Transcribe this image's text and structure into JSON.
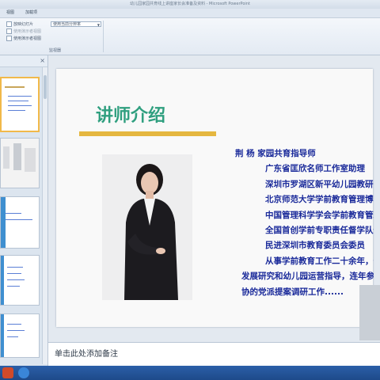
{
  "window": {
    "title": "幼儿园家园共育线上讲座家长会准备及资料 - Microsoft PowerPoint"
  },
  "menu": {
    "items": [
      "视图",
      "加载项"
    ]
  },
  "ribbon": {
    "options": [
      "放映幻灯片",
      "使用演示者视图",
      "使用演示者视图"
    ],
    "combo_value": "使用当前分辨率",
    "group_label": "监视器"
  },
  "slide": {
    "title": "讲师介绍",
    "bio_lines": [
      "荆  杨   家园共育指导师",
      "广东省匡欣名师工作室助理",
      "深圳市罗湖区新平幼儿园教研员",
      "北京师范大学学前教育管理博士",
      "中国管理科学学会学前教育管理",
      "全国首创学前专职责任督学队伍",
      "民进深圳市教育委员会委员",
      "从事学前教育工作二十余年，长",
      "发展研究和幼儿园运营指导，连年参与",
      "协的党派提案调研工作......"
    ]
  },
  "notes": {
    "placeholder": "单击此处添加备注"
  },
  "thumbnails": [
    {
      "label": ""
    },
    {
      "label": ""
    },
    {
      "label": ""
    },
    {
      "label": ""
    },
    {
      "label": ""
    }
  ],
  "colors": {
    "title": "#2f9f7f",
    "accent_bar": "#e5b740",
    "bio_text": "#1a2a9a",
    "taskbar": "#1e4a8a"
  }
}
